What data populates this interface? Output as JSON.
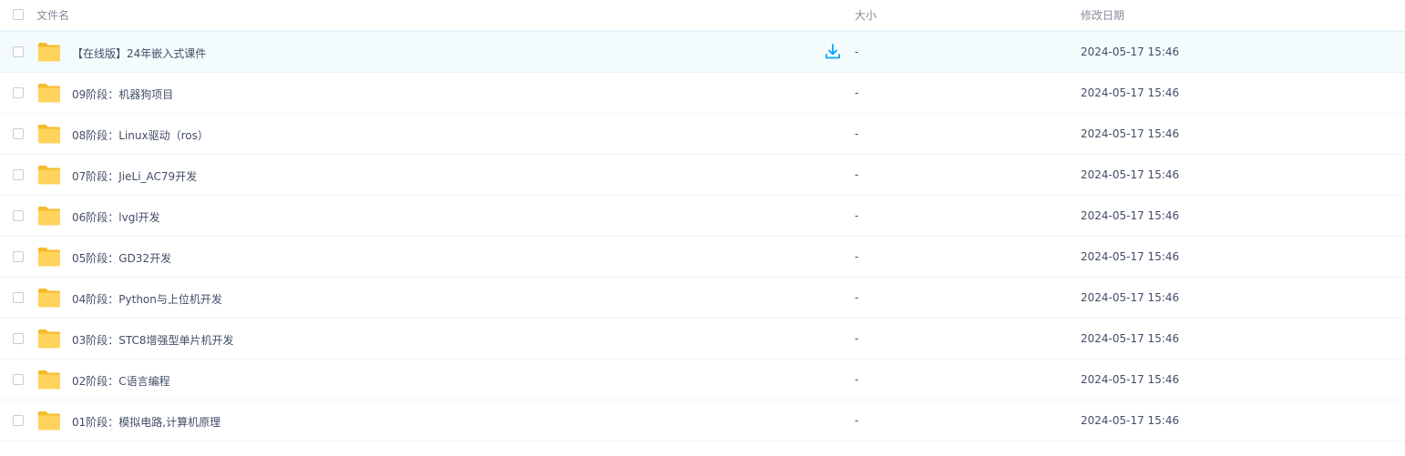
{
  "header": {
    "name_label": "文件名",
    "size_label": "大小",
    "date_label": "修改日期"
  },
  "files": [
    {
      "name": "【在线版】24年嵌入式课件",
      "size": "-",
      "modified": "2024-05-17 15:46"
    },
    {
      "name": "09阶段：机器狗项目",
      "size": "-",
      "modified": "2024-05-17 15:46"
    },
    {
      "name": "08阶段：Linux驱动（ros）",
      "size": "-",
      "modified": "2024-05-17 15:46"
    },
    {
      "name": "07阶段：JieLi_AC79开发",
      "size": "-",
      "modified": "2024-05-17 15:46"
    },
    {
      "name": "06阶段：lvgl开发",
      "size": "-",
      "modified": "2024-05-17 15:46"
    },
    {
      "name": "05阶段：GD32开发",
      "size": "-",
      "modified": "2024-05-17 15:46"
    },
    {
      "name": "04阶段：Python与上位机开发",
      "size": "-",
      "modified": "2024-05-17 15:46"
    },
    {
      "name": "03阶段：STC8增强型单片机开发",
      "size": "-",
      "modified": "2024-05-17 15:46"
    },
    {
      "name": "02阶段：C语言编程",
      "size": "-",
      "modified": "2024-05-17 15:46"
    },
    {
      "name": "01阶段：模拟电路,计算机原理",
      "size": "-",
      "modified": "2024-05-17 15:46"
    }
  ],
  "icons": {
    "folder": "folder-icon",
    "download": "download-icon"
  },
  "colors": {
    "folder": "#ffd050",
    "folder_dark": "#f5bb2b",
    "accent": "#06a7ff",
    "hover_row": "#f4fbfd"
  }
}
